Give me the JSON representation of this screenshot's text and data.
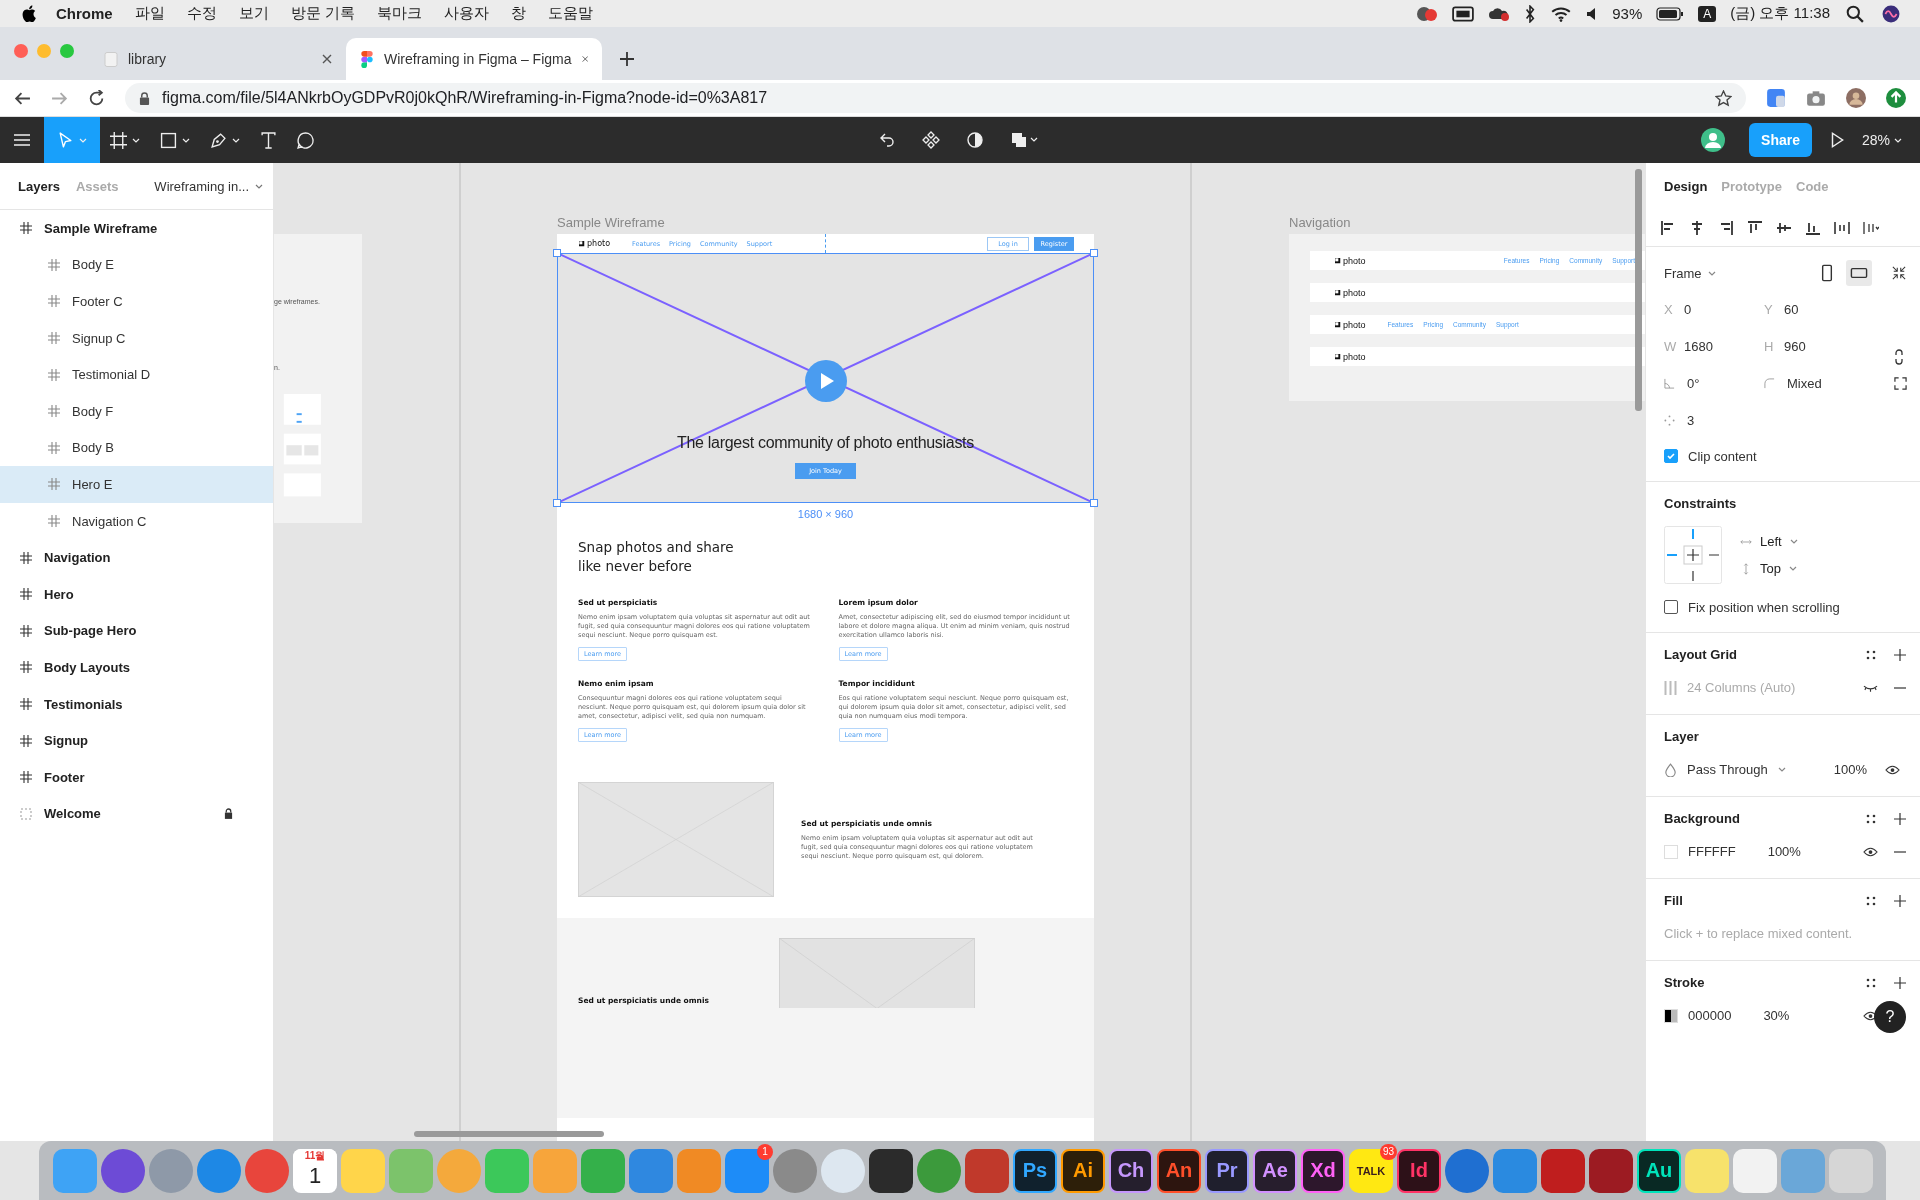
{
  "menubar": {
    "app": "Chrome",
    "menus": [
      "파일",
      "수정",
      "보기",
      "방문 기록",
      "북마크",
      "사용자",
      "창",
      "도움말"
    ],
    "battery": "93%",
    "input_source": "A",
    "clock": "(금) 오후 11:38"
  },
  "browser": {
    "tabs": [
      {
        "title": "library",
        "selected": false
      },
      {
        "title": "Wireframing in Figma – Figma",
        "selected": true
      }
    ],
    "url": "figma.com/file/5l4ANkrbOyGDPvR0j0kQhR/Wireframing-in-Figma?node-id=0%3A817"
  },
  "toolbar": {
    "tools": [
      {
        "kind": "move",
        "selected": true
      },
      {
        "kind": "frame",
        "selected": false
      },
      {
        "kind": "shape",
        "selected": false
      },
      {
        "kind": "pen",
        "selected": false
      },
      {
        "kind": "text",
        "selected": false
      },
      {
        "kind": "comment",
        "selected": false
      }
    ],
    "share": "Share",
    "zoom": "28%"
  },
  "layers_panel": {
    "tabs": [
      {
        "label": "Layers",
        "selected": true
      },
      {
        "label": "Assets",
        "selected": false
      }
    ],
    "page": "Wireframing in...",
    "layers": [
      {
        "name": "Sample Wireframe",
        "kind": "frame",
        "locked": false,
        "selected": false,
        "children": [
          {
            "name": "Body E",
            "selected": false
          },
          {
            "name": "Footer C",
            "selected": false
          },
          {
            "name": "Signup C",
            "selected": false
          },
          {
            "name": "Testimonial D",
            "selected": false
          },
          {
            "name": "Body F",
            "selected": false
          },
          {
            "name": "Body B",
            "selected": false
          },
          {
            "name": "Hero E",
            "selected": true
          },
          {
            "name": "Navigation C",
            "selected": false
          }
        ]
      },
      {
        "name": "Navigation",
        "kind": "frame",
        "locked": false,
        "selected": false
      },
      {
        "name": "Hero",
        "kind": "frame",
        "locked": false,
        "selected": false
      },
      {
        "name": "Sub-page Hero",
        "kind": "frame",
        "locked": false,
        "selected": false
      },
      {
        "name": "Body Layouts",
        "kind": "frame",
        "locked": false,
        "selected": false
      },
      {
        "name": "Testimonials",
        "kind": "frame",
        "locked": false,
        "selected": false
      },
      {
        "name": "Signup",
        "kind": "frame",
        "locked": false,
        "selected": false
      },
      {
        "name": "Footer",
        "kind": "frame",
        "locked": false,
        "selected": false
      },
      {
        "name": "Welcome",
        "kind": "section",
        "locked": true,
        "selected": false
      }
    ]
  },
  "canvas": {
    "side_frame": {
      "texts": [
        "ge wireframes.",
        "n."
      ]
    },
    "wireframe": {
      "label": "Sample Wireframe",
      "nav": {
        "logo": "photo",
        "links": [
          "Features",
          "Pricing",
          "Community",
          "Support"
        ],
        "login": "Log in",
        "register": "Register"
      },
      "hero": {
        "headline": "The largest community of photo enthusiasts",
        "cta": "Join Today",
        "selected": true,
        "size": "1680 × 960"
      },
      "intro": {
        "heading": "Snap photos and share like never before",
        "features": [
          {
            "title": "Sed ut perspiciatis",
            "text": "Nemo enim ipsam voluptatem quia voluptas sit aspernatur aut odit aut fugit, sed quia consequuntur magni dolores eos qui ratione voluptatem sequi nesciunt. Neque porro quisquam est.",
            "link": "Learn more"
          },
          {
            "title": "Lorem ipsum dolor",
            "text": "Amet, consectetur adipiscing elit, sed do eiusmod tempor incididunt ut labore et dolore magna aliqua. Ut enim ad minim veniam, quis nostrud exercitation ullamco laboris nisi.",
            "link": "Learn more"
          },
          {
            "title": "Nemo enim ipsam",
            "text": "Consequuntur magni dolores eos qui ratione voluptatem sequi nesciunt. Neque porro quisquam est, qui dolorem ipsum quia dolor sit amet, consectetur, adipisci velit, sed quia non numquam.",
            "link": "Learn more"
          },
          {
            "title": "Tempor incididunt",
            "text": "Eos qui ratione voluptatem sequi nesciunt. Neque porro quisquam est, qui dolorem ipsum quia dolor sit amet, consectetur, adipisci velit, sed quia non numquam eius modi tempora.",
            "link": "Learn more"
          }
        ]
      },
      "media": {
        "title": "Sed ut perspiciatis unde omnis",
        "text": "Nemo enim ipsam voluptatem quia voluptas sit aspernatur aut odit aut fugit, sed quia consequuntur magni dolores eos qui ratione voluptatem sequi nesciunt. Neque porro quisquam est, qui dolorem."
      },
      "next": {
        "title": "Sed ut perspiciatis unde omnis"
      }
    },
    "nav_frame": {
      "label": "Navigation",
      "bars": [
        {
          "kind": "links-right",
          "logo": "photo",
          "links": [
            "Features",
            "Pricing",
            "Community",
            "Support"
          ]
        },
        {
          "kind": "logo-only",
          "logo": "photo"
        },
        {
          "kind": "links-left",
          "logo": "photo",
          "links": [
            "Features",
            "Pricing",
            "Community",
            "Support"
          ]
        },
        {
          "kind": "logo-only",
          "logo": "photo"
        }
      ]
    }
  },
  "design_panel": {
    "tabs": [
      {
        "label": "Design",
        "selected": true
      },
      {
        "label": "Prototype",
        "selected": false
      },
      {
        "label": "Code",
        "selected": false
      }
    ],
    "frame": {
      "label": "Frame",
      "orientations": [
        {
          "kind": "portrait",
          "selected": false
        },
        {
          "kind": "landscape",
          "selected": true
        }
      ]
    },
    "fields": [
      {
        "label": "X",
        "value": "0"
      },
      {
        "label": "Y",
        "value": "60"
      },
      {
        "label": "W",
        "value": "1680"
      },
      {
        "label": "H",
        "value": "960"
      }
    ],
    "rotation": "0°",
    "corner": "Mixed",
    "radius": "3",
    "clip_content": {
      "label": "Clip content",
      "checked": true
    },
    "constraints": {
      "title": "Constraints",
      "horizontal": "Left",
      "vertical": "Top",
      "fix_position": {
        "label": "Fix position when scrolling",
        "checked": false
      }
    },
    "layout_grid": {
      "title": "Layout Grid",
      "grid": "24 Columns (Auto)",
      "visible": false
    },
    "layer": {
      "title": "Layer",
      "blend": "Pass Through",
      "opacity": "100%"
    },
    "background": {
      "title": "Background",
      "hex": "FFFFFF",
      "opacity": "100%"
    },
    "fill": {
      "title": "Fill",
      "hint": "Click + to replace mixed content."
    },
    "stroke": {
      "title": "Stroke",
      "hex": "000000",
      "opacity": "30%"
    },
    "help": "?"
  },
  "dock": [
    {
      "kind": "square",
      "color": "#3ea3f5"
    },
    {
      "kind": "circle",
      "color": "#6d4bd6"
    },
    {
      "kind": "circle",
      "color": "#8e99a8"
    },
    {
      "kind": "circle",
      "color": "#1e88e5"
    },
    {
      "kind": "circle",
      "color": "#e8453c"
    },
    {
      "kind": "calendar",
      "month": "11월",
      "day": "1",
      "color": "#e53935"
    },
    {
      "kind": "square",
      "color": "#ffd54a"
    },
    {
      "kind": "square",
      "color": "#7cc36b"
    },
    {
      "kind": "circle",
      "color": "#f4a93c"
    },
    {
      "kind": "square",
      "color": "#3cc85a"
    },
    {
      "kind": "square",
      "color": "#f7a53b"
    },
    {
      "kind": "square",
      "color": "#34b04a"
    },
    {
      "kind": "square",
      "color": "#2f88e0"
    },
    {
      "kind": "square",
      "color": "#f08a24"
    },
    {
      "kind": "square",
      "color": "#1d8cf8",
      "badge": "1"
    },
    {
      "kind": "circle",
      "color": "#8a8a8a"
    },
    {
      "kind": "circle",
      "color": "#dde7f0"
    },
    {
      "kind": "square",
      "color": "#2b2b2b"
    },
    {
      "kind": "circle",
      "color": "#3c9a3c"
    },
    {
      "kind": "square",
      "color": "#c0392b"
    },
    {
      "kind": "glyph",
      "label": "Ps",
      "color": "#31a8ff"
    },
    {
      "kind": "glyph",
      "label": "Ai",
      "color": "#ff9a00"
    },
    {
      "kind": "glyph",
      "label": "Ch",
      "color": "#c597fc"
    },
    {
      "kind": "glyph",
      "label": "An",
      "color": "#ff4f2a"
    },
    {
      "kind": "glyph",
      "label": "Pr",
      "color": "#9999ff"
    },
    {
      "kind": "glyph",
      "label": "Ae",
      "color": "#d291ff"
    },
    {
      "kind": "glyph",
      "label": "Xd",
      "color": "#ff61f6"
    },
    {
      "kind": "chat",
      "label": "TALK",
      "color": "#ffe812",
      "badge": "93"
    },
    {
      "kind": "glyph",
      "label": "Id",
      "color": "#ff3366"
    },
    {
      "kind": "circle",
      "color": "#1f6fd1"
    },
    {
      "kind": "square",
      "color": "#2a8ae0"
    },
    {
      "kind": "square",
      "color": "#bf1e1e"
    },
    {
      "kind": "square",
      "color": "#9c1b22"
    },
    {
      "kind": "glyph",
      "label": "Au",
      "color": "#00e4bb"
    },
    {
      "kind": "square",
      "color": "#f7e26b"
    },
    {
      "kind": "square",
      "color": "#f2f2f2"
    },
    {
      "kind": "square",
      "color": "#6aa7d8"
    },
    {
      "kind": "square",
      "color": "#d6d6d6"
    }
  ]
}
